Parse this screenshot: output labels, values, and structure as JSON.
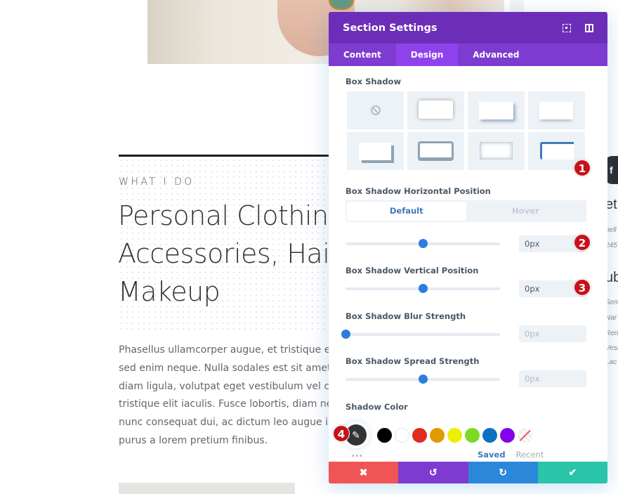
{
  "page": {
    "eyebrow": "WHAT I DO",
    "headline_lines": [
      "Personal Clothing,",
      "Accessories, Hair",
      "Makeup"
    ],
    "body_lines": [
      "Phasellus ullamcorper augue, et tristique elit i",
      "sed enim neque. Nulla sodales est sit amet di",
      "diam ligula, volutpat eget vestibulum vel conc",
      "tristique elit iaculis. Fusce lobortis, diam nec s",
      "nunc consequat dui, ac dictum leo augue id n",
      "purus a lorem pretium finibus."
    ],
    "right_peek": {
      "facebook_glyph": "f",
      "heading_1": "et",
      "lines_1": [
        "hell",
        "245"
      ],
      "heading_2": "ub",
      "lines_2": [
        "Sen",
        "Nar",
        "Ren",
        "Vesi",
        "Lac"
      ]
    }
  },
  "modal": {
    "title": "Section Settings",
    "header_icons": [
      "expand-icon",
      "split-view-icon"
    ],
    "tabs": [
      {
        "label": "Content",
        "active": false
      },
      {
        "label": "Design",
        "active": true
      },
      {
        "label": "Advanced",
        "active": false
      }
    ],
    "box_shadow": {
      "label": "Box Shadow",
      "presets": [
        "none",
        "all-around",
        "bottom-right",
        "bottom",
        "offset-bottom-right",
        "solid-all",
        "inset",
        "top-left-blue"
      ],
      "selected_preset": "top-left-blue"
    },
    "horizontal": {
      "label": "Box Shadow Horizontal Position",
      "toggle": {
        "default": "Default",
        "hover": "Hover",
        "active": "default"
      },
      "slider_fraction": 0.5,
      "value": "0px"
    },
    "vertical": {
      "label": "Box Shadow Vertical Position",
      "slider_fraction": 0.5,
      "value": "0px"
    },
    "blur": {
      "label": "Box Shadow Blur Strength",
      "slider_fraction": 0.0,
      "value": "0px"
    },
    "spread": {
      "label": "Box Shadow Spread Strength",
      "slider_fraction": 0.5,
      "value": "0px"
    },
    "shadow_color": {
      "label": "Shadow Color",
      "eyedropper_glyph": "✎",
      "swatches": [
        "#000000",
        "#ffffff",
        "#e02b20",
        "#e09900",
        "#edf000",
        "#7cda24",
        "#0c71c3",
        "#8300e9",
        "none"
      ],
      "more": "•••",
      "palette_tabs": [
        "Saved",
        "Recent"
      ],
      "active_palette": "Saved"
    },
    "footer": {
      "cancel": "✖",
      "undo": "↺",
      "redo": "↻",
      "save": "✔",
      "colors": {
        "cancel": "#ef5555",
        "undo": "#7e3bd0",
        "redo": "#2b87da",
        "save": "#29c4a9"
      }
    }
  },
  "annotations": [
    "1",
    "2",
    "3",
    "4"
  ],
  "colors": {
    "header": "#6c2eb9",
    "tabs": "#7d3bcf",
    "tab_active": "#8f42ec",
    "accent_blue": "#2b7ede",
    "badge_red": "#c8111a"
  }
}
